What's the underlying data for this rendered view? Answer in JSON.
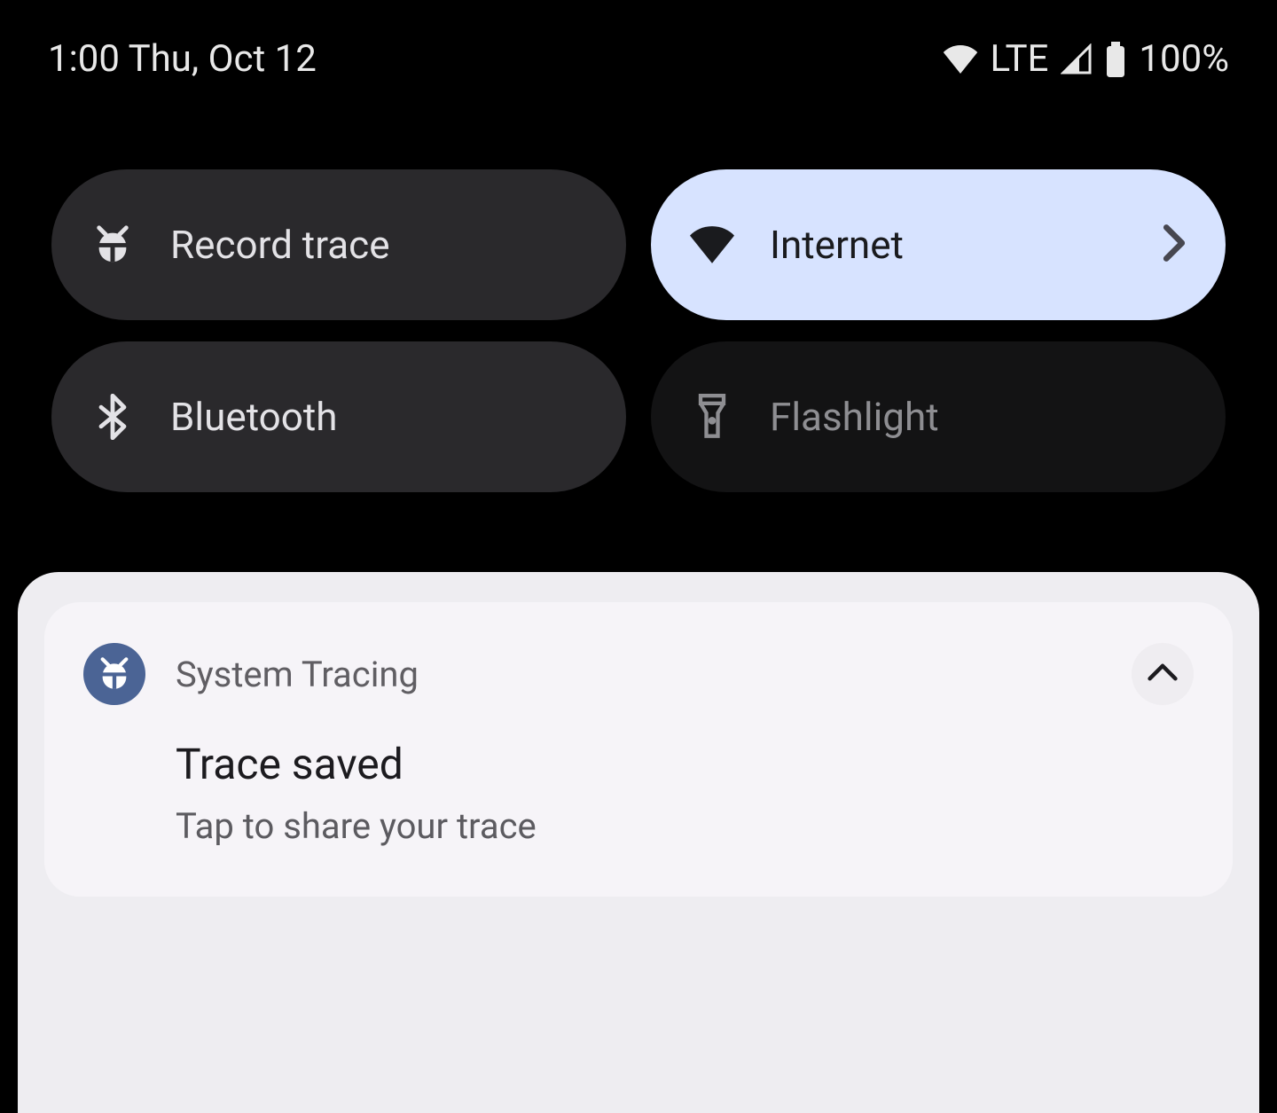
{
  "status_bar": {
    "time_date": "1:00 Thu, Oct 12",
    "network_label": "LTE",
    "battery_percent": "100%"
  },
  "quick_settings": {
    "tiles": [
      {
        "label": "Record trace",
        "icon": "bug-icon",
        "state": "inactive"
      },
      {
        "label": "Internet",
        "icon": "wifi-icon",
        "state": "active",
        "chevron": true
      },
      {
        "label": "Bluetooth",
        "icon": "bluetooth-icon",
        "state": "inactive"
      },
      {
        "label": "Flashlight",
        "icon": "flashlight-icon",
        "state": "disabled"
      }
    ]
  },
  "notification": {
    "app_name": "System Tracing",
    "title": "Trace saved",
    "subtitle": "Tap to share your trace"
  }
}
